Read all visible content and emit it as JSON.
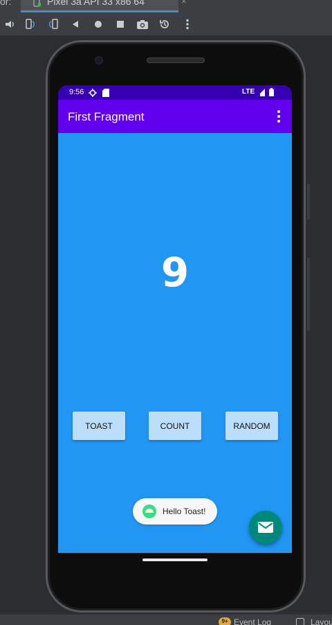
{
  "ide": {
    "tab_prefix": "or:",
    "tab_label": "Pixel 3a API 33 x86 64",
    "tab_close": "×",
    "toolbar_icons": [
      "volume-icon",
      "rotate-left-icon",
      "rotate-right-icon",
      "back-icon",
      "home-icon",
      "overview-icon",
      "camera-icon",
      "snapshot-icon",
      "more-icon"
    ],
    "accent": "#4a88c7"
  },
  "status_bar": {
    "time": "9:56",
    "network": "LTE",
    "color": "#3700b3"
  },
  "app_bar": {
    "title": "First Fragment",
    "color": "#6200ee"
  },
  "main": {
    "count": "9",
    "background": "#2196f3",
    "buttons": [
      {
        "label": "TOAST"
      },
      {
        "label": "COUNT"
      },
      {
        "label": "RANDOM"
      }
    ],
    "button_color": "#bbdefb"
  },
  "toast": {
    "text": "Hello Toast!"
  },
  "fab": {
    "icon": "email-icon",
    "color": "#00897b"
  },
  "ide_bottom": {
    "badge": "9+",
    "event_log": "Event Log",
    "layout": "Layou"
  }
}
